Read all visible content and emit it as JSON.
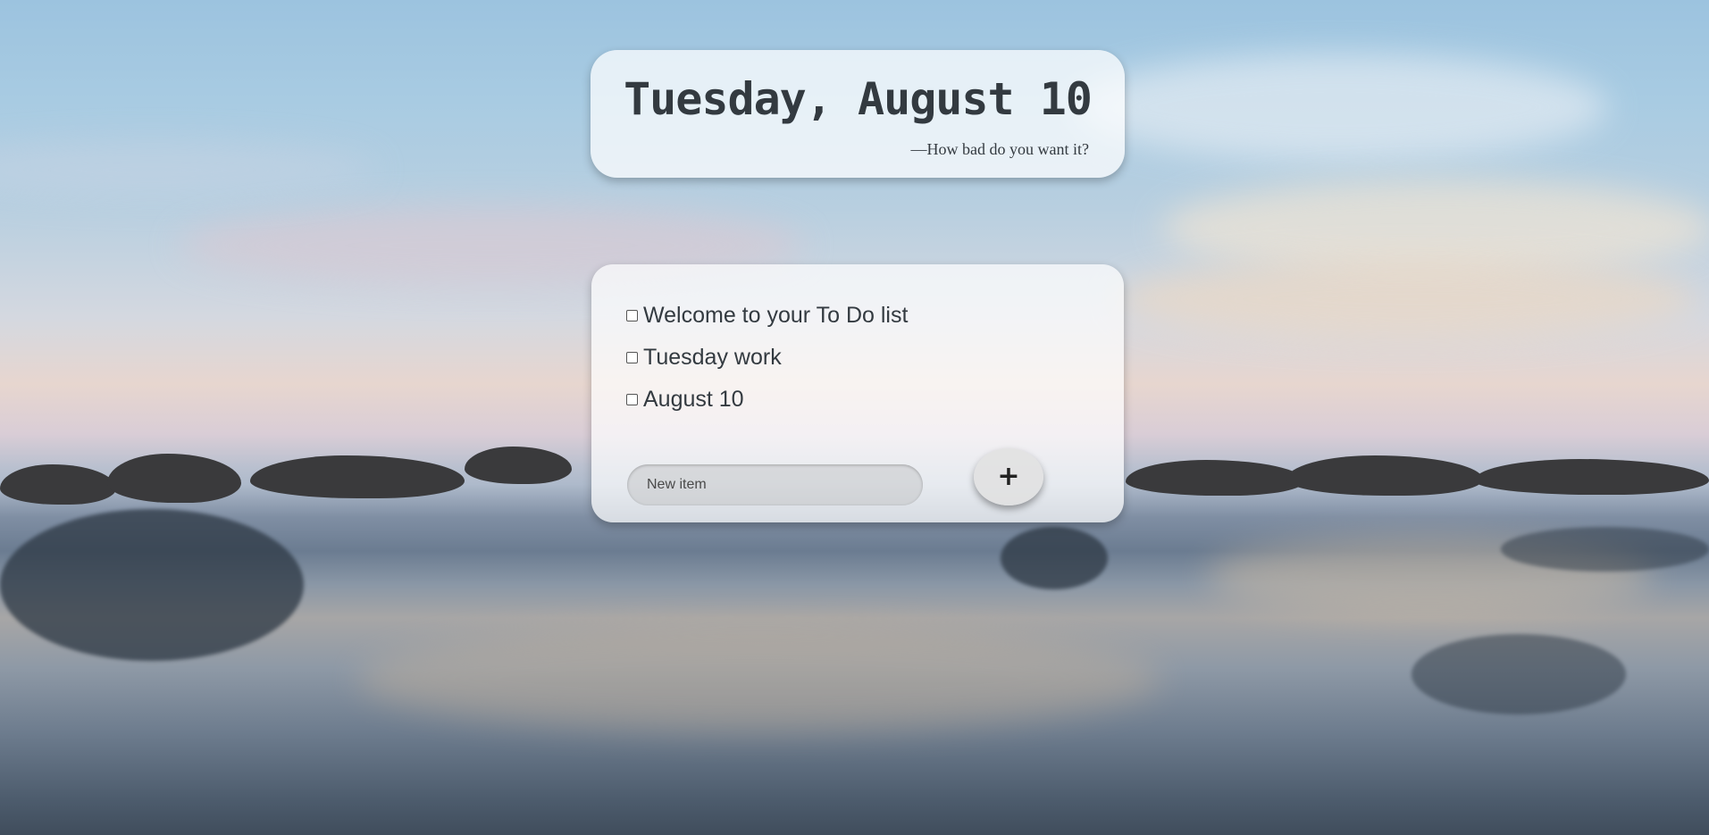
{
  "header": {
    "date": "Tuesday, August 10",
    "quote": "—How bad do you want it?"
  },
  "todo": {
    "items": [
      {
        "label": "Welcome to your To Do list",
        "checked": false
      },
      {
        "label": "Tuesday work",
        "checked": false
      },
      {
        "label": "August 10",
        "checked": false
      }
    ],
    "new_item_placeholder": "New item",
    "add_button_icon": "plus-icon",
    "add_button_symbol": "+"
  },
  "colors": {
    "text": "#333a40",
    "card_background": "rgba(255,255,255,0.7)"
  }
}
